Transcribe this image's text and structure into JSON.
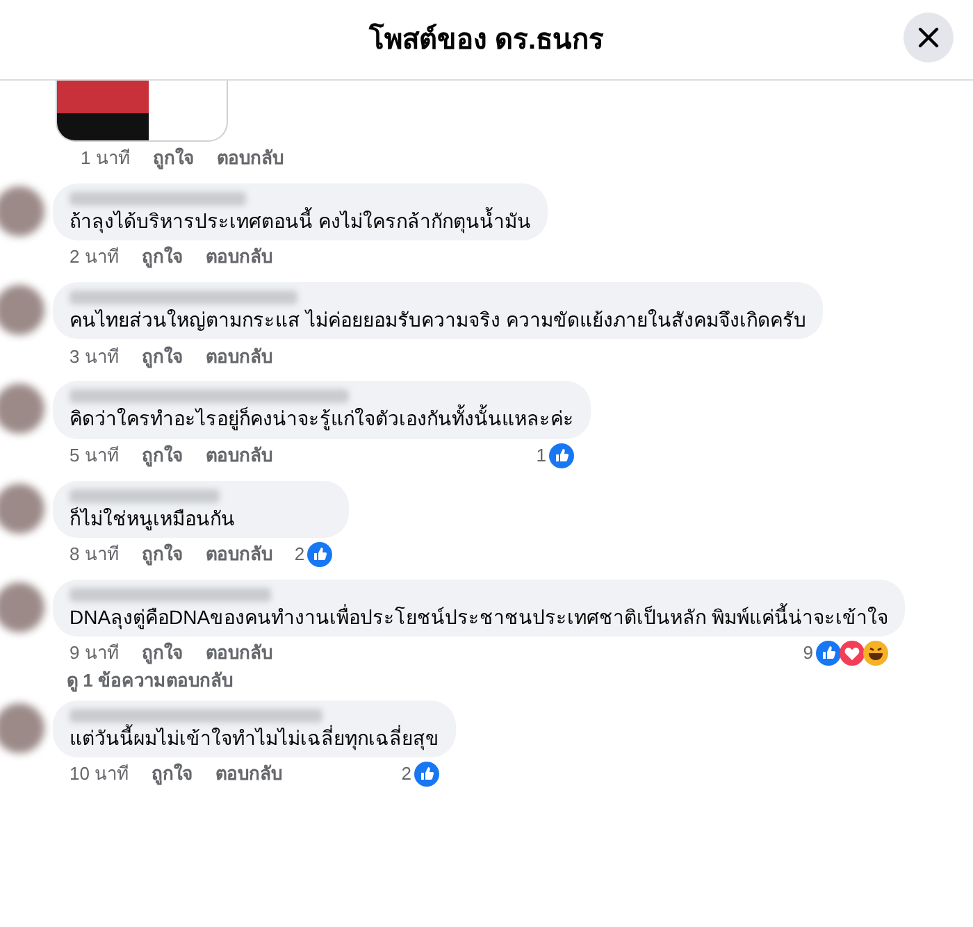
{
  "header": {
    "title": "โพสต์ของ ดร.ธนกร"
  },
  "comments": [
    {
      "kind": "media",
      "time": "1 นาที",
      "like_label": "ถูกใจ",
      "reply_label": "ตอบกลับ"
    },
    {
      "kind": "text",
      "text": "ถ้าลุงได้บริหารประเทศตอนนี้ คงไม่ใครกล้ากักตุนน้ำมัน",
      "time": "2 นาที",
      "like_label": "ถูกใจ",
      "reply_label": "ตอบกลับ"
    },
    {
      "kind": "text",
      "text": "คนไทยส่วนใหญ่ตามกระแส ไม่ค่อยยอมรับความจริง ความขัดแย้งภายในสังคมจึงเกิดครับ",
      "time": "3 นาที",
      "like_label": "ถูกใจ",
      "reply_label": "ตอบกลับ"
    },
    {
      "kind": "text",
      "text": "คิดว่าใครทำอะไรอยู่ก็คงน่าจะรู้แก่ใจตัวเองกันทั้งนั้นแหละค่ะ",
      "time": "5 นาที",
      "like_label": "ถูกใจ",
      "reply_label": "ตอบกลับ",
      "reaction_count": "1",
      "reactions": [
        {
          "kind": "like"
        }
      ]
    },
    {
      "kind": "text",
      "text": "ก็ไม่ใช่หนูเหมือนกัน",
      "time": "8 นาที",
      "like_label": "ถูกใจ",
      "reply_label": "ตอบกลับ",
      "reaction_count": "2",
      "reactions": [
        {
          "kind": "like"
        }
      ]
    },
    {
      "kind": "text",
      "text": "DNAลุงตู่คือDNAของคนทำงานเพื่อประโยชน์ประชาชนประเทศชาติเป็นหลัก พิมพ์แค่นี้น่าจะเข้าใจ",
      "time": "9 นาที",
      "like_label": "ถูกใจ",
      "reply_label": "ตอบกลับ",
      "reaction_count": "9",
      "reactions": [
        {
          "kind": "like"
        },
        {
          "kind": "love"
        },
        {
          "kind": "haha"
        }
      ],
      "replies_link": "ดู 1 ข้อความตอบกลับ"
    },
    {
      "kind": "text",
      "text": "แต่วันนี้ผมไม่เข้าใจทำไมไม่เฉลี่ยทุกเฉลี่ยสุข",
      "time": "10 นาที",
      "like_label": "ถูกใจ",
      "reply_label": "ตอบกลับ",
      "reaction_count": "2",
      "reactions": [
        {
          "kind": "like"
        }
      ]
    }
  ]
}
